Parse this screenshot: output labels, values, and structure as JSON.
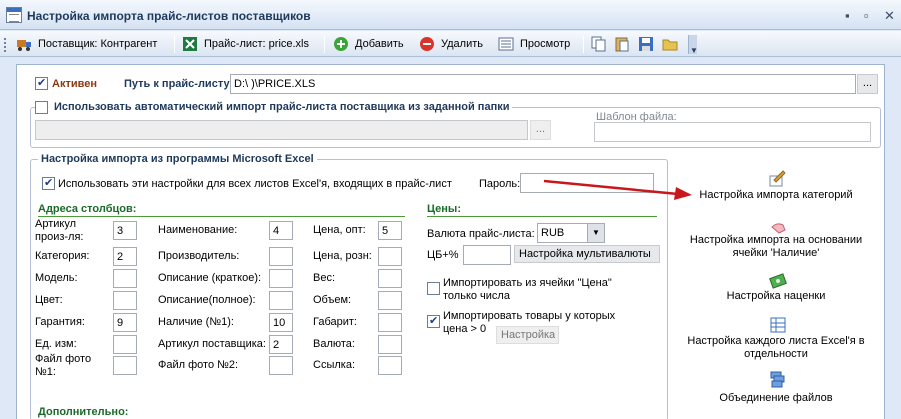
{
  "window": {
    "title": "Настройка импорта прайс-листов поставщиков"
  },
  "toolbar": {
    "supplier_label": "Поставщик: Контрагент",
    "pricelist_label": "Прайс-лист: price.xls",
    "add_label": "Добавить",
    "delete_label": "Удалить",
    "view_label": "Просмотр"
  },
  "top": {
    "active_label": "Активен",
    "path_label": "Путь к прайс-листу:",
    "path_value": "D:\\                                                                    )\\PRICE.XLS",
    "browse_label": "...",
    "auto_import_label": "Использовать автоматический импорт прайс-листа поставщика из заданной папки",
    "folder_browse_label": "...",
    "template_label": "Шаблон файла:",
    "template_value": ""
  },
  "excel": {
    "group_title": "Настройка импорта из программы Microsoft Excel",
    "use_all_sheets_label": "Использовать эти настройки для всех листов Excel'я, входящих в прайс-лист",
    "password_label": "Пароль:",
    "password_value": ""
  },
  "columns": {
    "title": "Адреса столбцов:",
    "col1": [
      {
        "label": "Артикул произ-ля:",
        "value": "3"
      },
      {
        "label": "Категория:",
        "value": "2"
      },
      {
        "label": "Модель:",
        "value": ""
      },
      {
        "label": "Цвет:",
        "value": ""
      },
      {
        "label": "Гарантия:",
        "value": "9"
      },
      {
        "label": "Ед. изм:",
        "value": ""
      },
      {
        "label": "Файл фото №1:",
        "value": ""
      }
    ],
    "col2": [
      {
        "label": "Наименование:",
        "value": "4"
      },
      {
        "label": "Производитель:",
        "value": ""
      },
      {
        "label": "Описание (краткое):",
        "value": ""
      },
      {
        "label": "Описание(полное):",
        "value": ""
      },
      {
        "label": "Наличие (№1):",
        "value": "10"
      },
      {
        "label": "Артикул поставщика:",
        "value": "2"
      },
      {
        "label": "Файл фото №2:",
        "value": ""
      }
    ],
    "col3": [
      {
        "label": "Цена, опт:",
        "value": "5"
      },
      {
        "label": "Цена, розн:",
        "value": ""
      },
      {
        "label": "Вес:",
        "value": ""
      },
      {
        "label": "Объем:",
        "value": ""
      },
      {
        "label": "Габарит:",
        "value": ""
      },
      {
        "label": "Валюта:",
        "value": ""
      },
      {
        "label": "Ссылка:",
        "value": ""
      }
    ]
  },
  "prices": {
    "title": "Цены:",
    "currency_label": "Валюта прайс-листа:",
    "currency_value": "RUB",
    "cb_label": "ЦБ+%",
    "cb_value": "",
    "multicurrency_button": "Настройка мультивалюты",
    "import_cell_label": "Импортировать из ячейки \"Цена\" только числа",
    "import_positive_label": "Импортировать товары у которых цена > 0",
    "settings_button": "Настройка"
  },
  "additional": {
    "title": "Дополнительно:"
  },
  "right_links": [
    {
      "label": "Настройка импорта категорий"
    },
    {
      "label": "Настройка импорта на основании ячейки 'Наличие'"
    },
    {
      "label": "Настройка наценки"
    },
    {
      "label": "Настройка каждого листа Excel'я в отдельности"
    },
    {
      "label": "Объединение файлов"
    }
  ],
  "colors": {
    "accent": "#1e395b",
    "section_green": "#1b6c2a",
    "arrow_red": "#c8181c",
    "window_bg": "#dfe8f6"
  }
}
